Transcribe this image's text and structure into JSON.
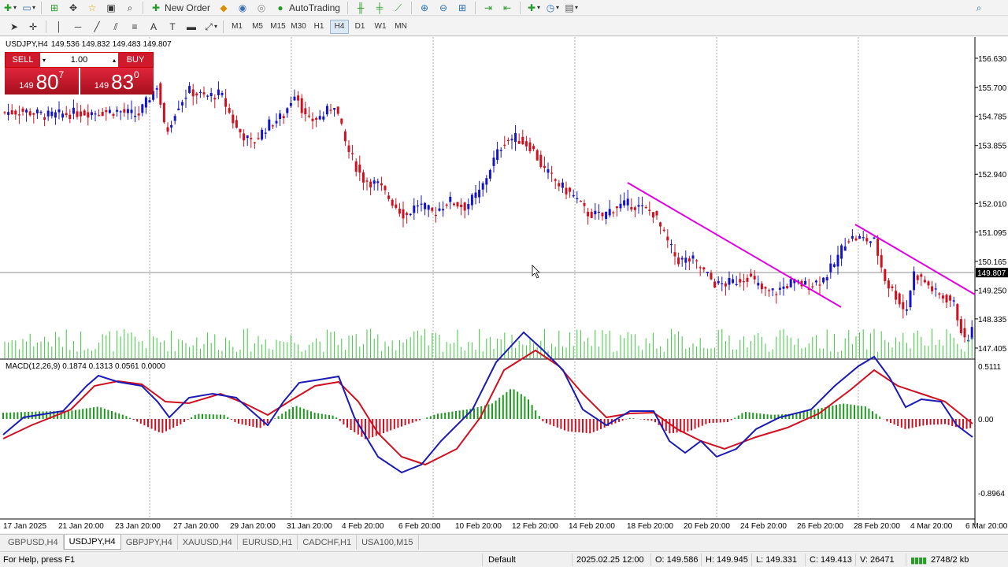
{
  "toolbar": {
    "new_order_label": "New Order",
    "autotrading_label": "AutoTrading",
    "timeframes": [
      "M1",
      "M5",
      "M15",
      "M30",
      "H1",
      "H4",
      "D1",
      "W1",
      "MN"
    ],
    "active_timeframe": "H4"
  },
  "chart": {
    "symbol_title": "USDJPY,H4",
    "ohlc": "149.536 149.832 149.483 149.807",
    "price_labels": [
      "156.630",
      "155.700",
      "154.785",
      "153.855",
      "152.940",
      "152.010",
      "151.095",
      "150.165",
      "149.250",
      "148.335",
      "147.405"
    ],
    "current_price": "149.807",
    "time_labels": [
      "17 Jan 2025",
      "21 Jan 20:00",
      "23 Jan 20:00",
      "27 Jan 20:00",
      "29 Jan 20:00",
      "31 Jan 20:00",
      "4 Feb 20:00",
      "6 Feb 20:00",
      "10 Feb 20:00",
      "12 Feb 20:00",
      "14 Feb 20:00",
      "18 Feb 20:00",
      "20 Feb 20:00",
      "24 Feb 20:00",
      "26 Feb 20:00",
      "28 Feb 20:00",
      "4 Mar 20:00",
      "6 Mar 20:00"
    ],
    "bull_color": "#1414c8",
    "bear_color": "#d0101e",
    "trendline_color": "#e000e0"
  },
  "one_click": {
    "sell_label": "SELL",
    "buy_label": "BUY",
    "lot": "1.00",
    "sell_small": "149",
    "sell_big": "80",
    "sell_sup": "7",
    "buy_small": "149",
    "buy_big": "83",
    "buy_sup": "0"
  },
  "macd": {
    "title": "MACD(12,26,9) 0.1874 0.1313 0.0561 0.0000",
    "scale_labels": [
      "0.5111",
      "0.00",
      "-0.8964"
    ],
    "macd_color": "#1a1ab4",
    "signal_color": "#d01020",
    "pos_hist_color": "#1e9a1e",
    "neg_hist_color": "#d01020"
  },
  "tabs": [
    "GBPUSD,H4",
    "USDJPY,H4",
    "GBPJPY,H4",
    "XAUUSD,H4",
    "EURUSD,H1",
    "CADCHF,H1",
    "USA100,M15"
  ],
  "active_tab": "USDJPY,H4",
  "status": {
    "help": "For Help, press F1",
    "profile": "Default",
    "datetime": "2025.02.25 12:00",
    "open": "O: 149.586",
    "high": "H: 149.945",
    "low": "L: 149.331",
    "close": "C: 149.413",
    "volume": "V: 26471",
    "traffic": "2748/2 kb"
  }
}
